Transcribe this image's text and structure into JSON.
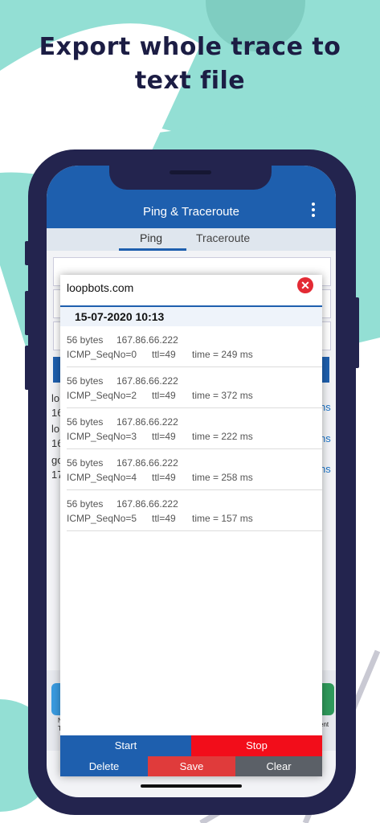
{
  "headline": {
    "line1": "Export whole trace to",
    "line2": "text file"
  },
  "app": {
    "title": "Ping & Traceroute",
    "tabs": [
      {
        "label": "Ping"
      },
      {
        "label": "Traceroute"
      }
    ],
    "active_tab": "Ping"
  },
  "background_list": {
    "rows": [
      {
        "prefix": "lo",
        "sub": "16",
        "suffix": "ns"
      },
      {
        "prefix": "lo",
        "sub": "16",
        "suffix": "ns"
      },
      {
        "prefix": "go",
        "sub": "17",
        "suffix": "ns"
      }
    ]
  },
  "dock": {
    "labels": [
      "N",
      "T",
      "ent"
    ]
  },
  "dialog": {
    "host": "loopbots.com",
    "date": "15-07-2020 10:13",
    "entries": [
      {
        "bytes": "56 bytes",
        "ip": "167.86.66.222",
        "seq": "ICMP_SeqNo=0",
        "ttl": "ttl=49",
        "time": "time = 249 ms"
      },
      {
        "bytes": "56 bytes",
        "ip": "167.86.66.222",
        "seq": "ICMP_SeqNo=2",
        "ttl": "ttl=49",
        "time": "time = 372 ms"
      },
      {
        "bytes": "56 bytes",
        "ip": "167.86.66.222",
        "seq": "ICMP_SeqNo=3",
        "ttl": "ttl=49",
        "time": "time = 222 ms"
      },
      {
        "bytes": "56 bytes",
        "ip": "167.86.66.222",
        "seq": "ICMP_SeqNo=4",
        "ttl": "ttl=49",
        "time": "time = 258 ms"
      },
      {
        "bytes": "56 bytes",
        "ip": "167.86.66.222",
        "seq": "ICMP_SeqNo=5",
        "ttl": "ttl=49",
        "time": "time = 157 ms"
      }
    ],
    "buttons": {
      "start": "Start",
      "stop": "Stop",
      "delete": "Delete",
      "save": "Save",
      "clear": "Clear"
    }
  },
  "colors": {
    "mint": "#93dfd4",
    "navy": "#1c1d44",
    "phone": "#23244e",
    "appbar": "#1e5fae",
    "stop": "#f20d1a",
    "save": "#e03b3b",
    "clear": "#5b6067"
  },
  "icons": {
    "close": "close-circle-icon",
    "menu": "more-vert-icon"
  }
}
